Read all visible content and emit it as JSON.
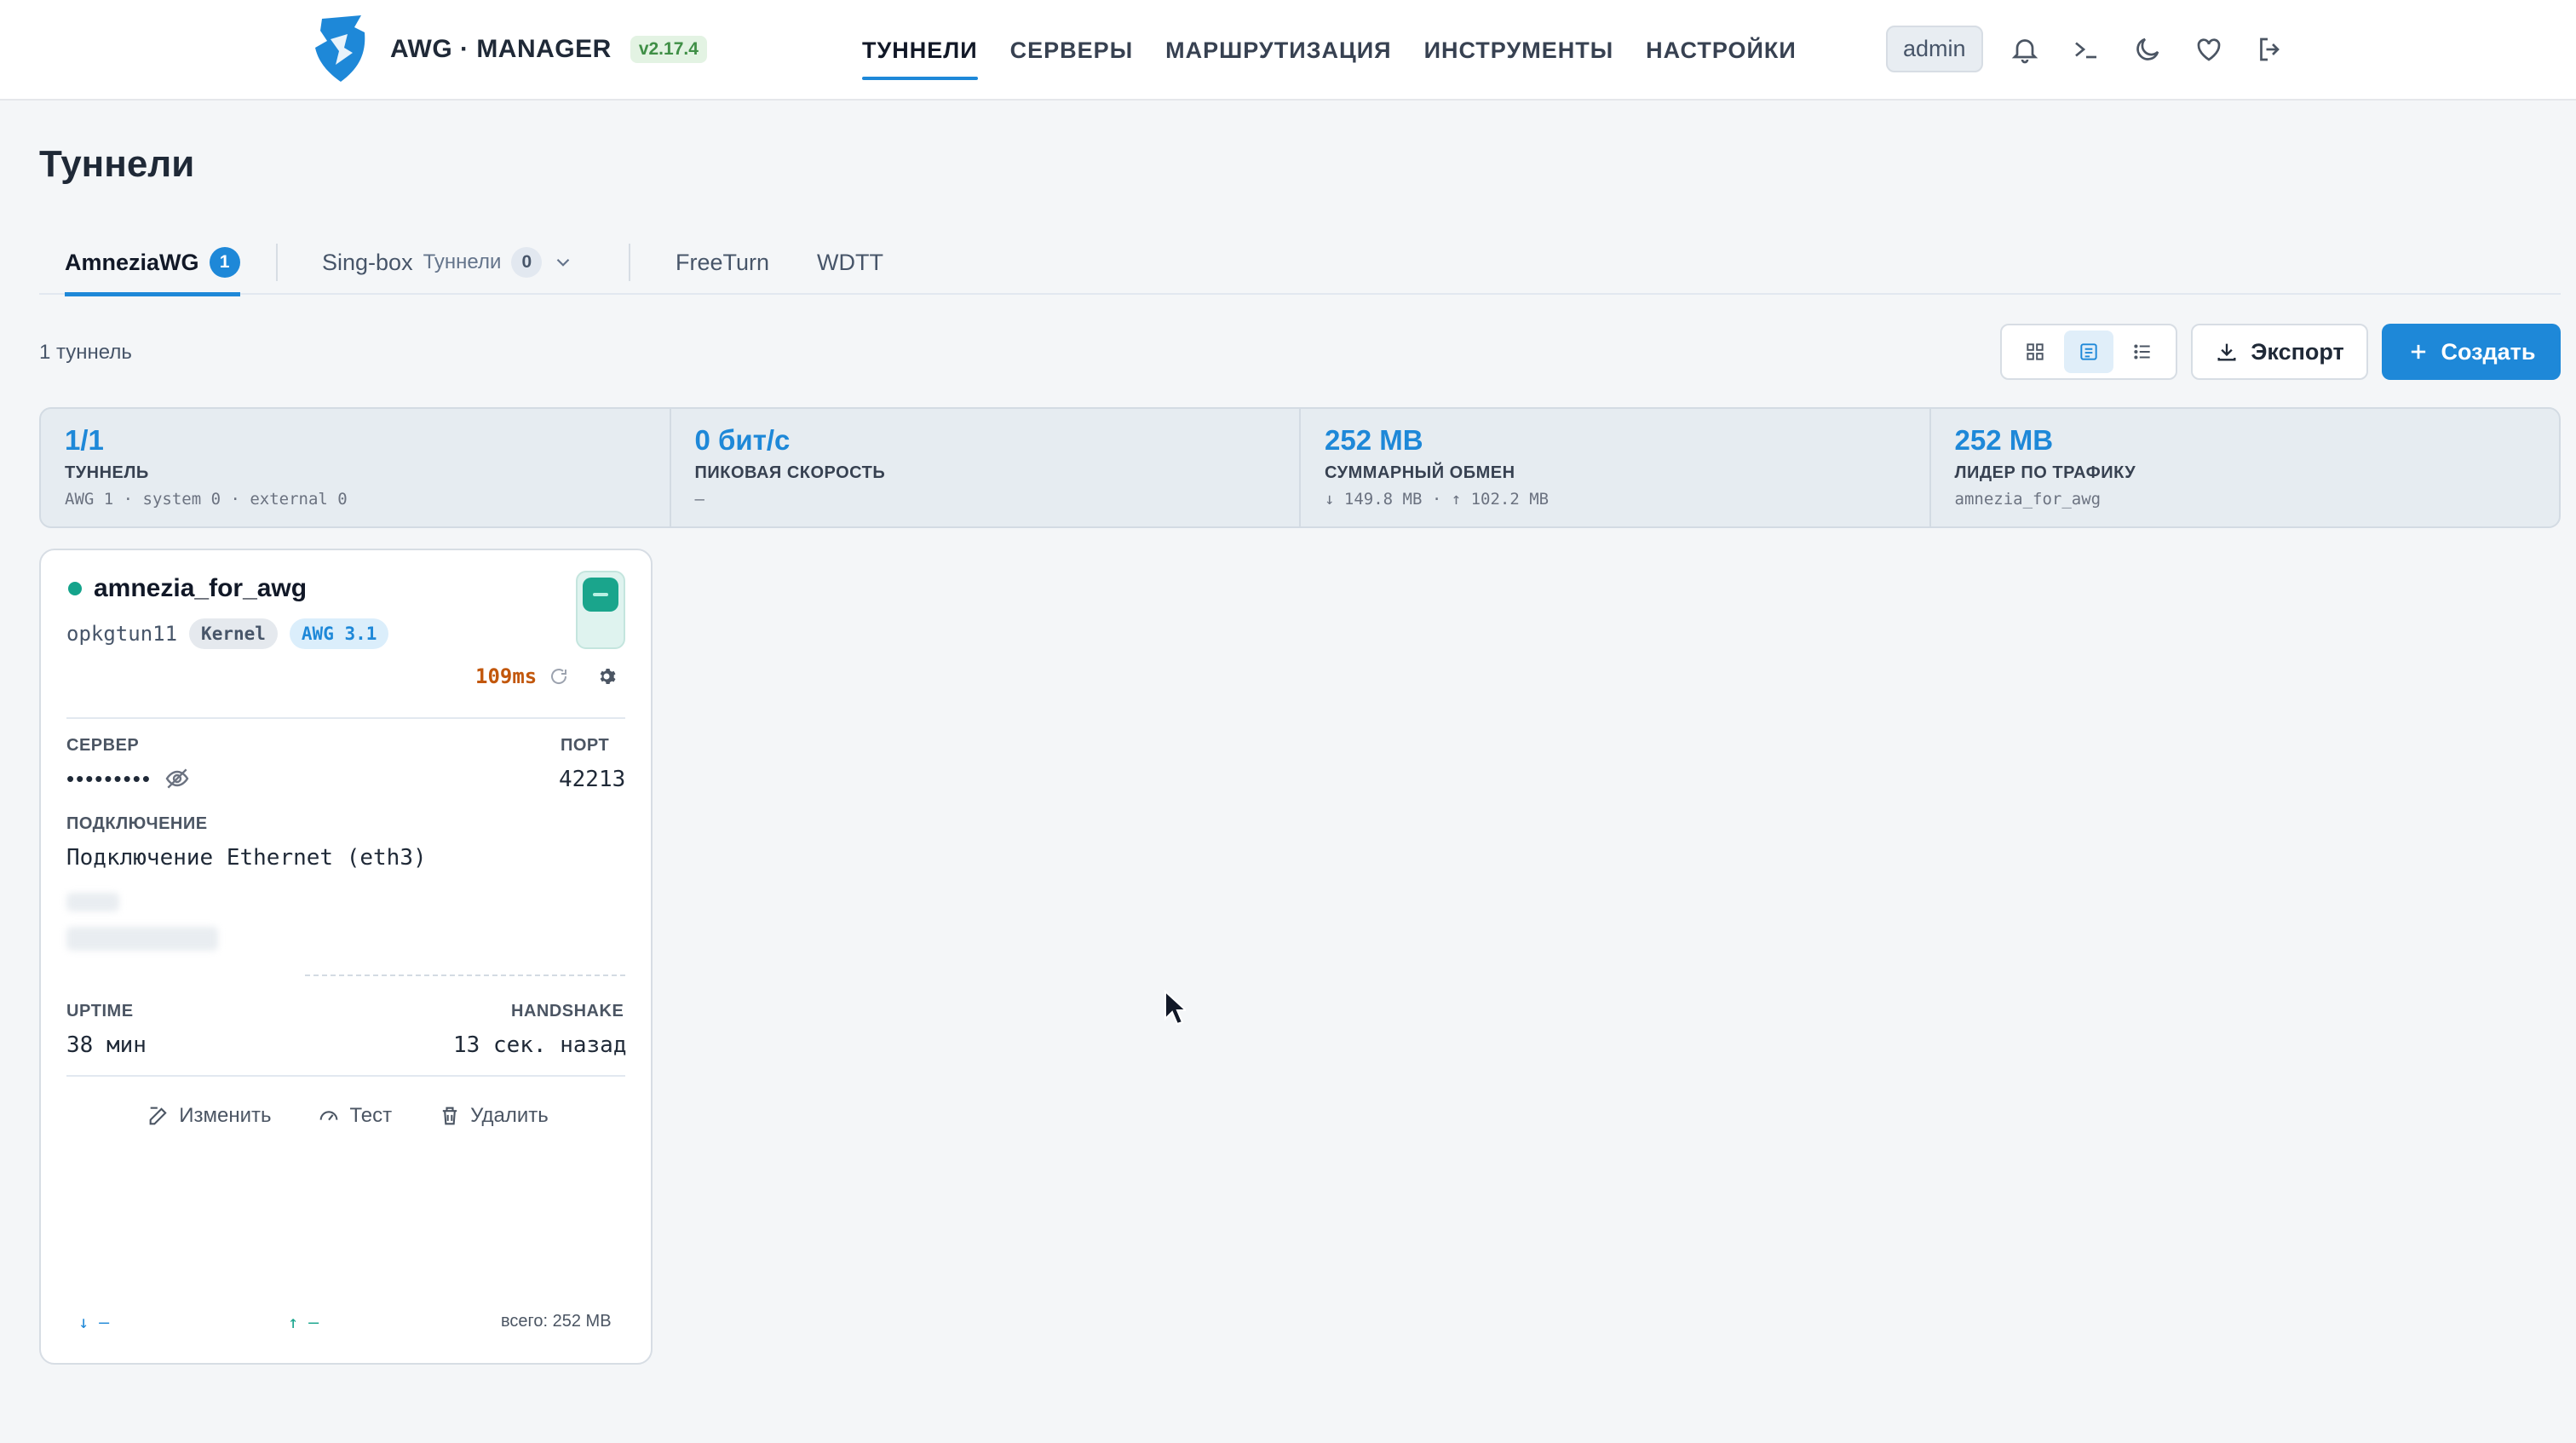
{
  "header": {
    "logo_text": "AWG · MANAGER",
    "version": "v2.17.4",
    "nav": [
      "ТУННЕЛИ",
      "СЕРВЕРЫ",
      "МАРШРУТИЗАЦИЯ",
      "ИНСТРУМЕНТЫ",
      "НАСТРОЙКИ"
    ],
    "user": "admin",
    "icons": [
      "bell-icon",
      "terminal-icon",
      "moon-icon",
      "heart-icon",
      "logout-icon"
    ]
  },
  "page": {
    "title": "Туннели",
    "tabs": [
      {
        "label": "AmneziaWG",
        "count": "1"
      },
      {
        "label": "Sing-box",
        "sub": "Туннели",
        "count": "0"
      },
      {
        "label": "FreeTurn"
      },
      {
        "label": "WDTT"
      }
    ],
    "count_label": "1 туннель",
    "export_label": "Экспорт",
    "create_label": "Создать"
  },
  "stats": [
    {
      "value": "1/1",
      "label": "ТУННЕЛЬ",
      "sub": "AWG 1 · system 0 · external 0"
    },
    {
      "value": "0 бит/с",
      "label": "ПИКОВАЯ СКОРОСТЬ",
      "sub": "—"
    },
    {
      "value": "252 MB",
      "label": "СУММАРНЫЙ ОБМЕН",
      "sub": "↓ 149.8 MB · ↑ 102.2 MB"
    },
    {
      "value": "252 MB",
      "label": "ЛИДЕР ПО ТРАФИКУ",
      "sub": "amnezia_for_awg"
    }
  ],
  "tunnel": {
    "name": "amnezia_for_awg",
    "interface": "opkgtun11",
    "tag_kernel": "Kernel",
    "tag_awg": "AWG 3.1",
    "ping": "109ms",
    "server_label": "СЕРВЕР",
    "server_value": "•••••••••",
    "port_label": "ПОРТ",
    "port_value": "42213",
    "connection_label": "ПОДКЛЮЧЕНИЕ",
    "connection_value": "Подключение Ethernet (eth3)",
    "uptime_label": "UPTIME",
    "uptime_value": "38 мин",
    "handshake_label": "HANDSHAKE",
    "handshake_value": "13 сек. назад",
    "actions": [
      "Изменить",
      "Тест",
      "Удалить"
    ],
    "rx": "↓ —",
    "tx": "↑ —",
    "total": "всего: 252 MB",
    "status_color": "#14a38b"
  },
  "colors": {
    "accent": "#1e88d8",
    "success": "#14a38b",
    "ping": "#c2570c"
  }
}
